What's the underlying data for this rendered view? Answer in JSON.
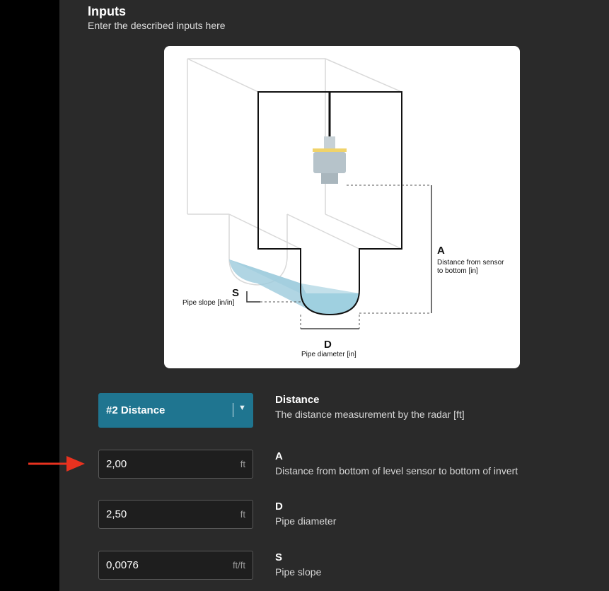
{
  "inputs": {
    "title": "Inputs",
    "subtitle": "Enter the described inputs here"
  },
  "diagram": {
    "label_a": "A",
    "label_a_desc1": "Distance from sensor",
    "label_a_desc2": "to bottom [in]",
    "label_s": "S",
    "label_s_desc": "Pipe slope [in/in]",
    "label_d": "D",
    "label_d_desc": "Pipe diameter [in]"
  },
  "distance": {
    "selected": "#2 Distance",
    "title": "Distance",
    "desc": "The distance measurement by the radar [ft]"
  },
  "field_a": {
    "value": "2,00",
    "unit": "ft",
    "title": "A",
    "desc": "Distance from bottom of level sensor to bottom of invert"
  },
  "field_d": {
    "value": "2,50",
    "unit": "ft",
    "title": "D",
    "desc": "Pipe diameter"
  },
  "field_s": {
    "value": "0,0076",
    "unit": "ft/ft",
    "title": "S",
    "desc": "Pipe slope"
  },
  "colors": {
    "accent": "#1f7590",
    "panel": "#2a2a2a",
    "arrow": "#e8321f"
  }
}
